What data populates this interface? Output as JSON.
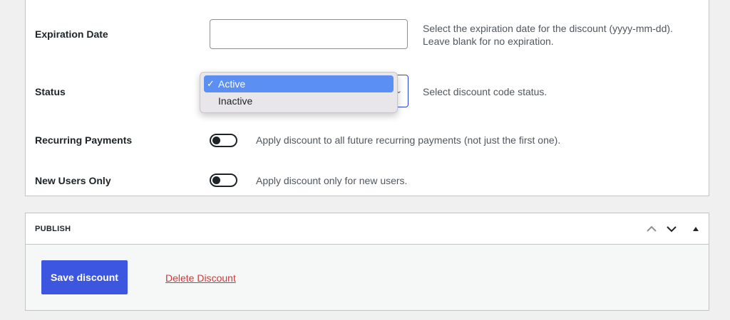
{
  "form": {
    "expiration": {
      "label": "Expiration Date",
      "value": "",
      "help": "Select the expiration date for the discount (yyyy-mm-dd).",
      "help2": "Leave blank for no expiration."
    },
    "status": {
      "label": "Status",
      "selected": "Active",
      "options": [
        "Active",
        "Inactive"
      ],
      "help": "Select discount code status."
    },
    "recurring": {
      "label": "Recurring Payments",
      "enabled": false,
      "help": "Apply discount to all future recurring payments (not just the first one)."
    },
    "new_users": {
      "label": "New Users Only",
      "enabled": false,
      "help": "Apply discount only for new users."
    }
  },
  "publish": {
    "title": "PUBLISH",
    "save_label": "Save discount",
    "delete_label": "Delete Discount",
    "controls": [
      "chevron-up-icon",
      "chevron-down-icon",
      "triangle-up-icon"
    ]
  },
  "colors": {
    "primary": "#3c56e0",
    "danger": "#d63638",
    "select_highlight": "#5b8ff2",
    "focus_border": "#2c47d6"
  }
}
